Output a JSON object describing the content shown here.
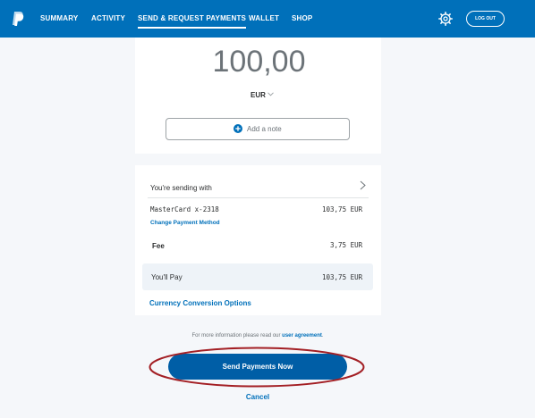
{
  "nav": {
    "items": [
      {
        "label": "SUMMARY",
        "active": false
      },
      {
        "label": "ACTIVITY",
        "active": false
      },
      {
        "label": "SEND & REQUEST PAYMENTS",
        "active": true
      },
      {
        "label": "WALLET",
        "active": false
      },
      {
        "label": "SHOP",
        "active": false
      }
    ],
    "logout_label": "LOG OUT",
    "icons": {
      "logo": "paypal-logo",
      "settings": "gear-icon"
    },
    "colors": {
      "bar": "#0070ba"
    }
  },
  "amount": {
    "value": "100,00",
    "currency": "EUR",
    "note_label": "Add a note"
  },
  "funding": {
    "header": "You're sending with",
    "method": "MasterCard x-2318",
    "method_amount": "103,75 EUR",
    "change_link": "Change Payment Method",
    "fee_label": "Fee",
    "fee_amount": "3,75 EUR",
    "pay_label": "You'll Pay",
    "pay_amount": "103,75 EUR",
    "conversion_link": "Currency Conversion Options"
  },
  "footer": {
    "info_prefix": "For more information please read our ",
    "info_link": "user agreement",
    "info_suffix": ".",
    "send_label": "Send Payments Now",
    "cancel_label": "Cancel"
  },
  "colors": {
    "accent": "#0070ba",
    "button": "#005ea6",
    "highlight_ellipse": "#a31f24"
  }
}
